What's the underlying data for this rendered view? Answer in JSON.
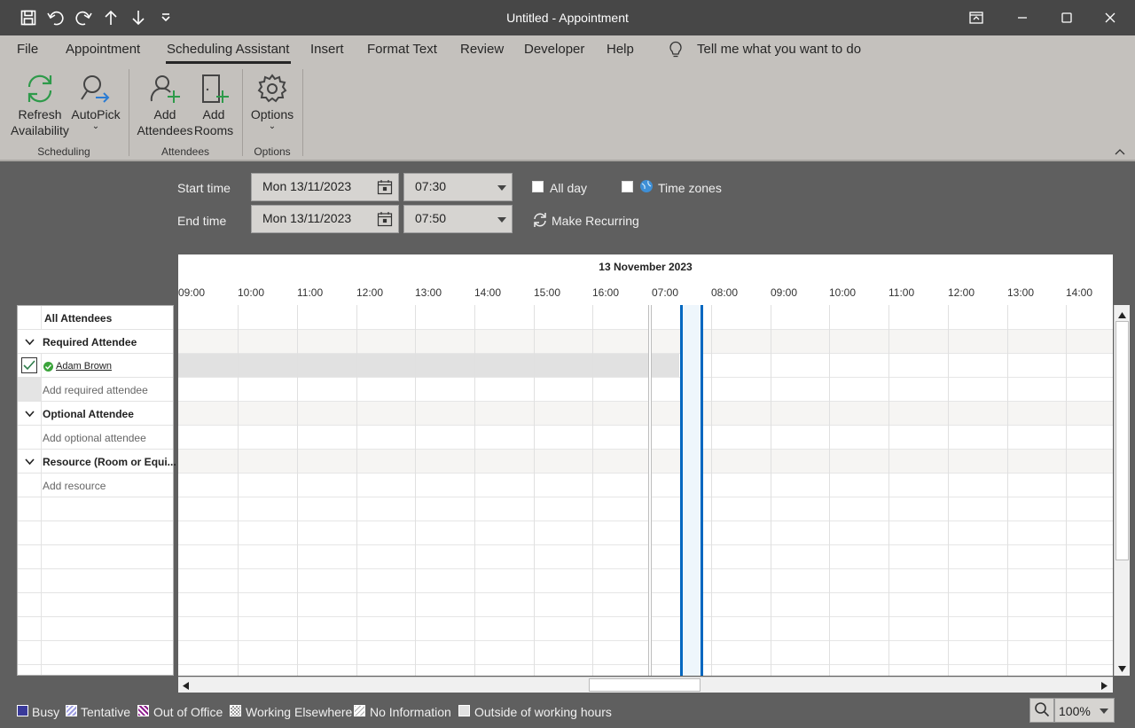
{
  "window": {
    "title": "Untitled  -  Appointment"
  },
  "menu": {
    "items": [
      "File",
      "Appointment",
      "Scheduling Assistant",
      "Insert",
      "Format Text",
      "Review",
      "Developer",
      "Help"
    ],
    "active": "Scheduling Assistant",
    "tell_me": "Tell me what you want to do"
  },
  "ribbon": {
    "refresh": [
      "Refresh",
      "Availability"
    ],
    "autopick": "AutoPick",
    "add_attendees": [
      "Add",
      "Attendees"
    ],
    "add_rooms": [
      "Add",
      "Rooms"
    ],
    "options": "Options",
    "groups": [
      "Scheduling",
      "Attendees",
      "Options"
    ]
  },
  "form": {
    "start_label": "Start time",
    "end_label": "End time",
    "start_date": "Mon 13/11/2023",
    "start_time": "07:30",
    "end_date": "Mon 13/11/2023",
    "end_time": "07:50",
    "all_day": "All day",
    "time_zones": "Time zones",
    "make_recurring": "Make Recurring"
  },
  "timeline": {
    "date": "13 November 2023",
    "hours": [
      "09:00",
      "10:00",
      "11:00",
      "12:00",
      "13:00",
      "14:00",
      "15:00",
      "16:00",
      "07:00",
      "08:00",
      "09:00",
      "10:00",
      "11:00",
      "12:00",
      "13:00",
      "14:00"
    ]
  },
  "attendees": {
    "header": "All Attendees",
    "required_section": "Required Attendee",
    "attendee_name": "Adam Brown",
    "add_required": "Add required attendee",
    "optional_section": "Optional Attendee",
    "add_optional": "Add optional attendee",
    "resource_section": "Resource (Room or Equi...",
    "add_resource": "Add resource"
  },
  "legend": {
    "busy": "Busy",
    "tentative": "Tentative",
    "out_of_office": "Out of Office",
    "working_elsewhere": "Working Elsewhere",
    "no_information": "No Information",
    "outside_hours": "Outside of working hours",
    "zoom": "100%"
  },
  "colors": {
    "accent": "#0067c0",
    "busy": "#3a3a9a",
    "ooo": "#8b1c8b"
  }
}
